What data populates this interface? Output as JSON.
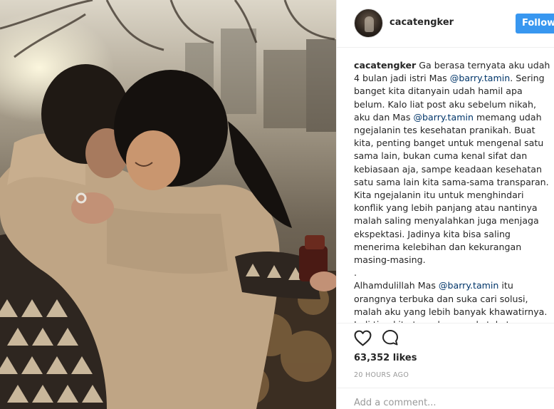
{
  "post": {
    "image_alt": "Couple hugging outdoors",
    "header": {
      "username": "cacatengker",
      "follow_label": "Follow"
    },
    "caption": {
      "username": "cacatengker",
      "segments": [
        {
          "type": "text",
          "value": " Ga berasa ternyata aku udah 4 bulan jadi istri Mas "
        },
        {
          "type": "mention",
          "value": "@barry.tamin"
        },
        {
          "type": "text",
          "value": ". Sering banget kita ditanyain udah hamil apa belum. Kalo liat post aku sebelum nikah, aku dan Mas "
        },
        {
          "type": "mention",
          "value": "@barry.tamin"
        },
        {
          "type": "text",
          "value": " memang udah ngejalanin tes kesehatan pranikah. Buat kita, penting banget untuk mengenal satu sama lain, bukan cuma kenal sifat dan kebiasaan aja, sampe keadaan kesehatan satu sama lain kita sama-sama transparan. Kita ngejalanin itu untuk menghindari konflik yang lebih panjang atau nantinya malah saling menyalahkan juga menjaga ekspektasi. Jadinya kita bisa saling menerima kelebihan dan kekurangan masing-masing."
        }
      ],
      "dot_line": ".",
      "second_paragraph": [
        {
          "type": "text",
          "value": "Alhamdulillah Mas "
        },
        {
          "type": "mention",
          "value": "@barry.tamin"
        },
        {
          "type": "text",
          "value": " itu orangnya terbuka dan suka cari solusi, malah aku yang lebih banyak khawatirnya. Jadi tiap kita tes, aku yang ketakutan."
        }
      ]
    },
    "actions": {
      "like_icon": "heart-outline-icon",
      "comment_icon": "speech-bubble-icon"
    },
    "likes_text": "63,352 likes",
    "timestamp": "20 hours ago",
    "comment_placeholder": "Add a comment..."
  },
  "colors": {
    "follow_button": "#3897f0",
    "mention": "#003569",
    "muted": "#999999",
    "text": "#262626"
  }
}
